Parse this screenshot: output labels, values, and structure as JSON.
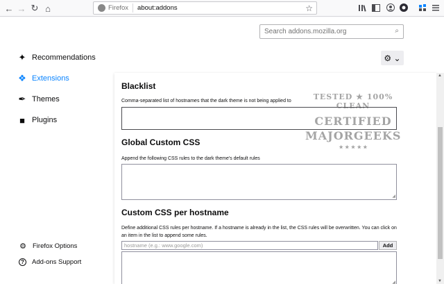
{
  "browser": {
    "back_icon": "←",
    "forward_icon": "→",
    "reload_icon": "↻",
    "home_icon": "⌂",
    "identity_label": "Firefox",
    "url": "about:addons",
    "bookmark_icon": "☆"
  },
  "search": {
    "placeholder": "Search addons.mozilla.org",
    "icon": "⌕"
  },
  "sidebar": {
    "items": [
      {
        "label": "Recommendations",
        "icon": "✦"
      },
      {
        "label": "Extensions",
        "icon": "❖"
      },
      {
        "label": "Themes",
        "icon": "✒"
      },
      {
        "label": "Plugins",
        "icon": "■"
      }
    ],
    "footer": [
      {
        "label": "Firefox Options",
        "icon": "⚙"
      },
      {
        "label": "Add-ons Support",
        "icon": "?"
      }
    ]
  },
  "tools_button": {
    "icon": "⚙ ⌄"
  },
  "sections": {
    "blacklist": {
      "title": "Blacklist",
      "desc": "Comma-separated list of hostnames that the dark theme is not being applied to"
    },
    "global_css": {
      "title": "Global Custom CSS",
      "desc": "Append the following CSS rules to the dark theme's default rules"
    },
    "per_host": {
      "title": "Custom CSS per hostname",
      "desc": "Define additional CSS rules per hostname. If a hostname is already in the list, the CSS rules will be overwritten. You can click on an item in the list to append some rules.",
      "input_placeholder": "hostname (e.g.: www.google.com)",
      "add_label": "Add"
    }
  },
  "watermark": {
    "line1": "TESTED ★ 100% CLEAN",
    "line2": "CERTIFIED",
    "line3": "MAJORGEEKS",
    "line4": "★ ★ ★ ★ ★"
  },
  "colors": {
    "accent": "#0a84ff",
    "page_bg": "#ffffff",
    "chrome_bg": "#f9f9fa"
  }
}
